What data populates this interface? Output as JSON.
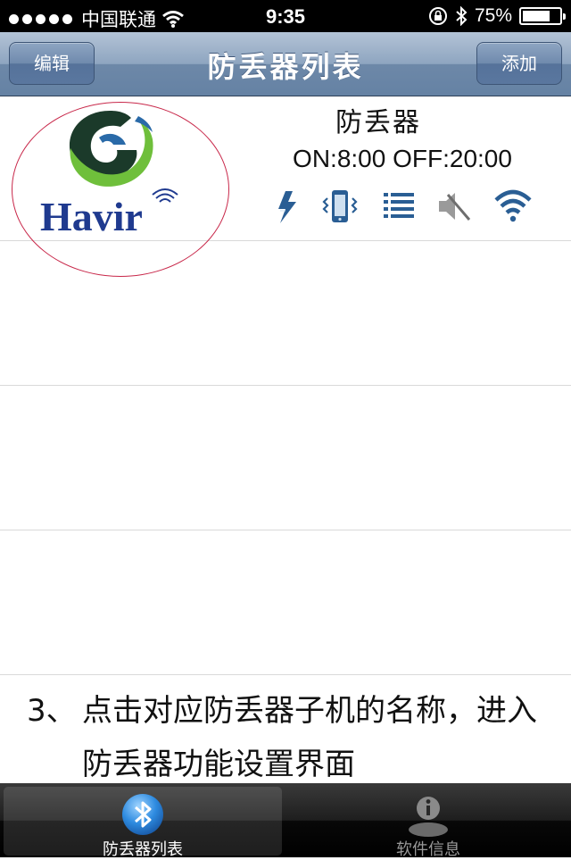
{
  "status_bar": {
    "carrier": "中国联通",
    "time": "9:35",
    "battery_percent": "75%",
    "battery_level": 0.75,
    "icons": [
      "signal-dots",
      "wifi-icon",
      "rotation-lock-icon",
      "bluetooth-icon",
      "battery-icon"
    ]
  },
  "nav": {
    "left_button": "编辑",
    "title": "防丢器列表",
    "right_button": "添加"
  },
  "devices": [
    {
      "logo_text": "Havir",
      "name": "防丢器",
      "schedule": "ON:8:00 OFF:20:00",
      "status_icons": [
        "lightning-icon",
        "vibrate-phone-icon",
        "list-icon",
        "mute-icon",
        "wifi-signal-icon"
      ]
    }
  ],
  "instruction": {
    "number": "3、",
    "line1": "点击对应防丢器子机的名称，进入",
    "line2": "防丢器功能设置界面"
  },
  "tabs": [
    {
      "label": "防丢器列表",
      "icon": "bluetooth-icon",
      "selected": true
    },
    {
      "label": "软件信息",
      "icon": "info-person-icon",
      "selected": false
    }
  ],
  "colors": {
    "nav_blue": "#6d88a8",
    "logo_green": "#6fbf3b",
    "logo_dark": "#1b3a2a",
    "logo_blue": "#1f3a8f",
    "icon_blue": "#2a5e94",
    "circle_red": "#c8284a"
  }
}
